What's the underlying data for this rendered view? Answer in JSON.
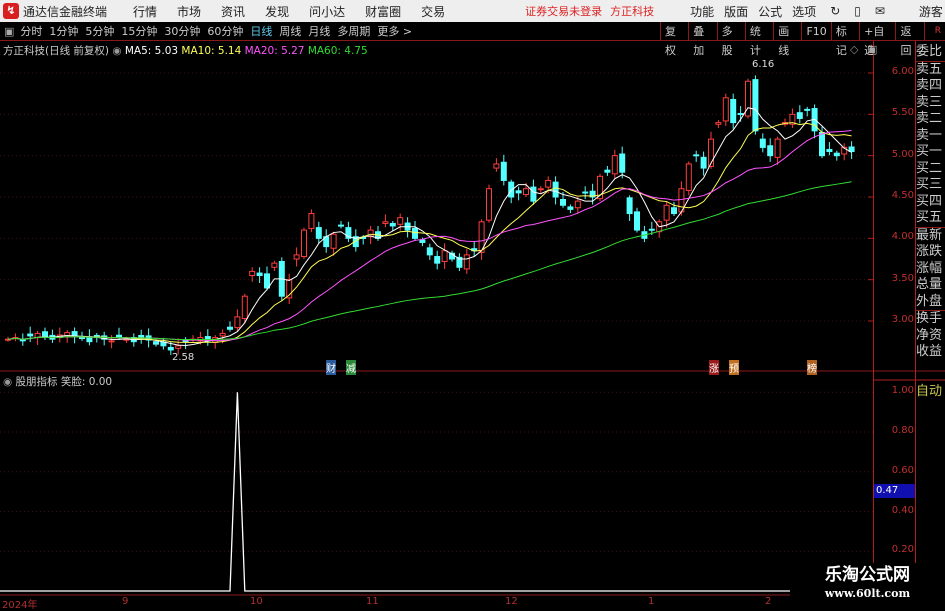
{
  "app": {
    "title": "通达信金融终端",
    "menus": [
      "行情",
      "市场",
      "资讯",
      "发现",
      "问小达",
      "财富圈",
      "交易"
    ],
    "login_status": "证券交易未登录",
    "stock_name": "方正科技",
    "right_menus": [
      "功能",
      "版面",
      "公式",
      "选项"
    ],
    "user": "游客"
  },
  "toolbar": {
    "periods": [
      "分时",
      "1分钟",
      "5分钟",
      "15分钟",
      "30分钟",
      "60分钟",
      "日线",
      "周线",
      "月线",
      "多周期",
      "更多 >"
    ],
    "active_period": "日线",
    "buttons": [
      "复权",
      "叠加",
      "多股",
      "统计",
      "画线",
      "F10",
      "标记",
      "+自选",
      "返回"
    ],
    "corner": "R"
  },
  "main": {
    "title": "方正科技(日线 前复权)",
    "ma5": "MA5: 5.03",
    "ma10": "MA10: 5.14",
    "ma20": "MA20: 5.27",
    "ma60": "MA60: 4.75",
    "high_label": "6.16",
    "low_label": "2.58",
    "event_tags": [
      {
        "text": "财",
        "color": "#2a5a9a"
      },
      {
        "text": "减",
        "color": "#2a8a3a"
      },
      {
        "text": "涨",
        "color": "#9a1a1a"
      },
      {
        "text": "预",
        "color": "#c07020"
      },
      {
        "text": "榜",
        "color": "#b06020"
      }
    ]
  },
  "colors": {
    "up": "#ff3c3c",
    "down": "#54ffff",
    "ma5": "#ffffff",
    "ma10": "#ffff54",
    "ma20": "#ff54ff",
    "ma60": "#32dc32",
    "axis": "#c03030"
  },
  "right_panel": {
    "items": [
      "委比",
      "卖五",
      "卖四",
      "卖三",
      "卖二",
      "卖一",
      "买一",
      "买二",
      "买三",
      "买四",
      "买五",
      "最新",
      "涨跌",
      "涨幅",
      "总量",
      "外盘",
      "换手",
      "净资",
      "收益"
    ],
    "auto": "自动"
  },
  "indicator": {
    "name": "股朋指标",
    "value_label": "笑脸: 0.00",
    "current": "0.47",
    "yticks": [
      "1.00",
      "0.80",
      "0.60",
      "0.40",
      "0.20"
    ]
  },
  "chart_data": {
    "type": "candlestick",
    "yticks": [
      "6.00",
      "5.50",
      "5.00",
      "4.50",
      "4.00",
      "3.50",
      "3.00"
    ],
    "x_labels": [
      "2024年",
      "9",
      "10",
      "11",
      "12",
      "1",
      "2"
    ],
    "closes": [
      2.78,
      2.8,
      2.76,
      2.82,
      2.85,
      2.8,
      2.78,
      2.83,
      2.86,
      2.82,
      2.79,
      2.75,
      2.8,
      2.78,
      2.76,
      2.8,
      2.78,
      2.75,
      2.8,
      2.77,
      2.72,
      2.7,
      2.65,
      2.7,
      2.75,
      2.78,
      2.8,
      2.76,
      2.8,
      2.85,
      2.9,
      3.05,
      3.3,
      3.6,
      3.55,
      3.4,
      3.7,
      3.3,
      3.5,
      3.8,
      4.1,
      4.3,
      4.0,
      3.9,
      4.05,
      4.15,
      4.0,
      3.9,
      4.0,
      4.1,
      4.0,
      4.2,
      4.15,
      4.25,
      4.1,
      4.0,
      3.95,
      3.8,
      3.7,
      3.85,
      3.75,
      3.65,
      3.8,
      3.85,
      4.2,
      4.6,
      4.9,
      4.7,
      4.5,
      4.55,
      4.6,
      4.45,
      4.6,
      4.7,
      4.5,
      4.4,
      4.35,
      4.45,
      4.55,
      4.5,
      4.75,
      4.8,
      5.0,
      4.8,
      4.3,
      4.1,
      4.0,
      4.1,
      4.2,
      4.4,
      4.3,
      4.6,
      4.9,
      5.0,
      4.85,
      5.2,
      5.4,
      5.7,
      5.4,
      5.5,
      5.9,
      5.3,
      5.1,
      5.0,
      5.2,
      5.4,
      5.5,
      5.45,
      5.55,
      5.3,
      5.0,
      5.05,
      5.0,
      5.1,
      5.05
    ],
    "indicator_values_spike_index": 31
  }
}
